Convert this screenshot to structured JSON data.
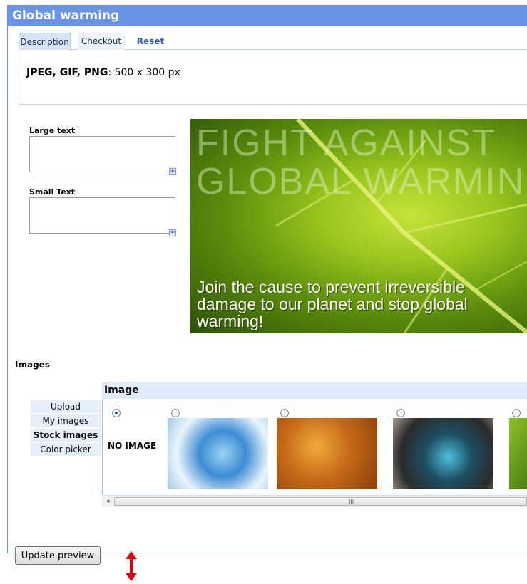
{
  "panel": {
    "title": "Global warming"
  },
  "tabs": [
    {
      "label": "Description"
    },
    {
      "label": "Checkout"
    },
    {
      "label": "Reset"
    }
  ],
  "description": {
    "formats": "JPEG, GIF, PNG",
    "size": ": 500 x 300 px"
  },
  "fields": {
    "large_text_label": "Large text",
    "small_text_label": "Small Text",
    "expand_symbol": "+"
  },
  "preview": {
    "large_line1": "FIGHT AGAINST",
    "large_line2": "GLOBAL WARMING",
    "small_text": "Join the cause to prevent irreversible damage to our planet and stop global warming!"
  },
  "images": {
    "heading": "Images",
    "menu": [
      {
        "label": "Upload"
      },
      {
        "label": "My images"
      },
      {
        "label": "Stock images",
        "active": true
      },
      {
        "label": "Color picker"
      }
    ],
    "panel_title": "Image",
    "no_image_label": "NO IMAGE",
    "thumbnails": [
      {
        "name": "water-globe-image"
      },
      {
        "name": "orange-texture-image"
      },
      {
        "name": "blue-abstract-image"
      },
      {
        "name": "green-leaf-image"
      }
    ],
    "scroll_grip": "III",
    "scroll_left": "◂"
  },
  "buttons": {
    "update_preview": "Update preview"
  },
  "colors": {
    "title_bar": "#6993e4",
    "panel_border": "#6f8fd9",
    "link": "#2f5bb8",
    "arrow": "#e00000"
  }
}
